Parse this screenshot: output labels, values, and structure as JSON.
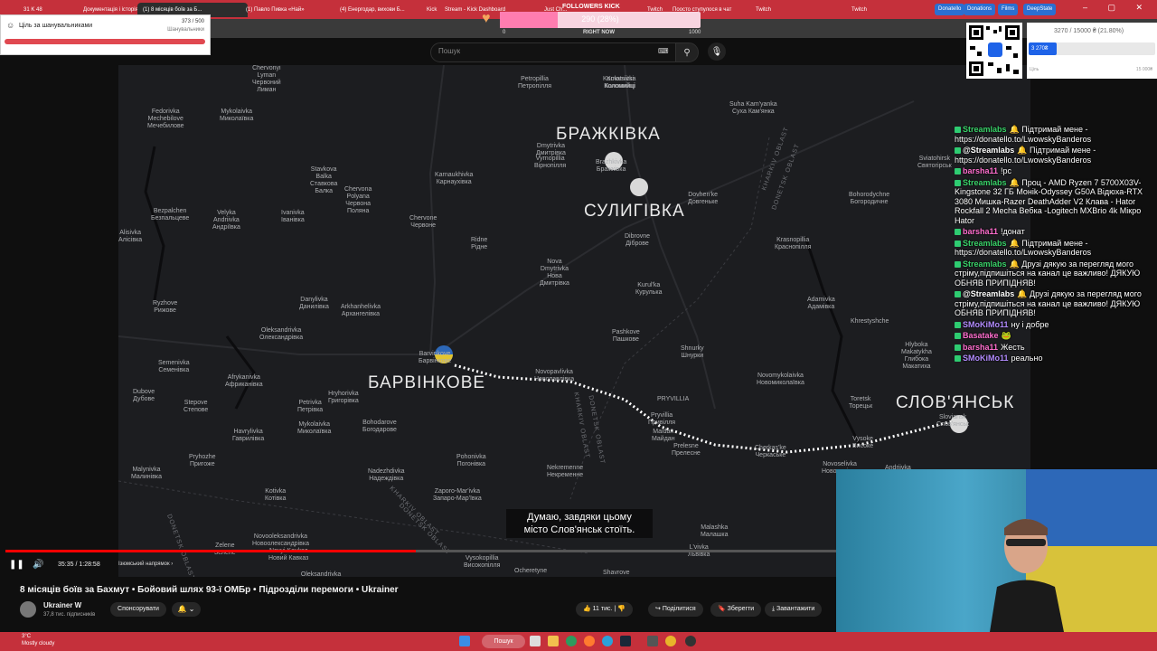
{
  "browser": {
    "tabs": [
      {
        "label": "31 K 48",
        "active": false
      },
      {
        "label": "Документація і історія",
        "active": false
      },
      {
        "label": "(1) 8 місяців боїв за Б...",
        "active": true
      },
      {
        "label": "(1) Павло Пивка «Най»",
        "active": false
      },
      {
        "label": "(4) Енергодар, вихови Б...",
        "active": false
      },
      {
        "label": "Kick",
        "active": false
      },
      {
        "label": "Stream - Kick Dashboard",
        "active": false
      },
      {
        "label": "Just Ch...",
        "active": false
      },
      {
        "label": "Twitch",
        "active": false
      },
      {
        "label": "Поосто ступулося в чат",
        "active": false
      },
      {
        "label": "Twitch",
        "active": false
      },
      {
        "label": "Twitch",
        "active": false
      }
    ],
    "bookmarks": [
      "Donatello",
      "Donations",
      "Films",
      "DeepState"
    ],
    "window_controls": "– ▢ ✕"
  },
  "youtube": {
    "search_placeholder": "Пошук",
    "video_title": "8 місяців боїв за Бахмут • Бойовий шлях 93-ї ОМБр • Підрозділи перемоги • Ukrainer",
    "channel": "Ukrainer W",
    "subscribers": "37,8 тис. підписників",
    "sponsor_label": "Спонсорувати",
    "bell_label": "🔔 ⌄",
    "actions": {
      "likes": "11 тис.",
      "share": "Поділитися",
      "save": "Зберегти",
      "download": "Завантажити"
    },
    "time": "35:35 / 1:28:58",
    "chapter": "Ізюмський напрямок ›",
    "progress": 0.4,
    "subtitle_line1": "Думаю, завдяки цьому",
    "subtitle_line2": "місто Слов'янськ стоїть."
  },
  "map": {
    "big_labels": {
      "brazh": "БРАЖКІВКА",
      "sulih": "СУЛИГІВКА",
      "barv": "БАРВІНКОВЕ",
      "slov": "СЛОВ'ЯНСЬК"
    },
    "oblast_labels": {
      "kharkiv1": "KHARKIV OBLAST",
      "donetsk1": "DONETSK OBLAST",
      "donetsk2": "DONETSK OBLAST",
      "kharkiv2": "KHARKIV OBLAST",
      "donetsk3": "DONETSK OBLAST",
      "donetsk4": "DONETSK OBLAST",
      "kharkiv3": "KHARKIV OBLAST"
    },
    "towns": [
      {
        "id": "chervonyi",
        "t": "Chervonyi\nLyman\nЧервоний\nЛиман"
      },
      {
        "id": "fedorivka",
        "t": "Fedorivka\nMechebilove\nМечебилове"
      },
      {
        "id": "mykolaivka1",
        "t": "Mykolaivka\nМиколаївка"
      },
      {
        "id": "petropillia",
        "t": "Petropillia\nПетропілля"
      },
      {
        "id": "kolomiitsi",
        "t": "Kolomiitsi\nКоломийці"
      },
      {
        "id": "kornatsivka",
        "t": "Kornatsivka\nКоломийці"
      },
      {
        "id": "suhaKam",
        "t": "Suha Kam'yanka\nСуха Кам'янка"
      },
      {
        "id": "dmytrivka",
        "t": "Dmytrivka\nДмитрівка"
      },
      {
        "id": "vyrnopillia",
        "t": "Vyrnopillia\nВірнопілля"
      },
      {
        "id": "karnaukhivka",
        "t": "Karnaukhivka\nКарнаухівка"
      },
      {
        "id": "stavkova",
        "t": "Stavkova\nBalka\nСтавкова\nБалка"
      },
      {
        "id": "chervona",
        "t": "Chervona\nPolyana\nЧервона\nПоляна"
      },
      {
        "id": "bezpalchen",
        "t": "Bezpalchen\nБезпальцеве"
      },
      {
        "id": "velyka",
        "t": "Velyka\nAndriivka\nАндріївка"
      },
      {
        "id": "ivanivka",
        "t": "Ivanivka\nІванівка"
      },
      {
        "id": "chervone",
        "t": "Chervone\nЧервоне"
      },
      {
        "id": "alisivka",
        "t": "Alisivka\nАлісівка"
      },
      {
        "id": "ridne",
        "t": "Ridne\nРідне"
      },
      {
        "id": "nova",
        "t": "Nova\nDmytrivka\nНова\nДмитрівка"
      },
      {
        "id": "dibrovne",
        "t": "Dibrovne\nДіброве"
      },
      {
        "id": "dovhenke",
        "t": "Dovhen'ke\nДовгеньке"
      },
      {
        "id": "bohorodychne",
        "t": "Bohorodychne\nБогородичне"
      },
      {
        "id": "kurulka",
        "t": "Kurul'ka\nКурулька"
      },
      {
        "id": "krasnopillia",
        "t": "Krasnopillia\nКраснопілля"
      },
      {
        "id": "ryzhove",
        "t": "Ryzhove\nРижове"
      },
      {
        "id": "danylivka",
        "t": "Danylivka\nДанилівка"
      },
      {
        "id": "arkhanhelivka",
        "t": "Arkhanhelivka\nАрхангелівка"
      },
      {
        "id": "adamivka",
        "t": "Adamivka\nАдамівка"
      },
      {
        "id": "oleksandrivka",
        "t": "Oleksandrivka\nОлександрівка"
      },
      {
        "id": "pashkove",
        "t": "Pashkove\nПашкове"
      },
      {
        "id": "khrestyshche",
        "t": "Khrestyshche"
      },
      {
        "id": "shnurky",
        "t": "Shnurky\nШнурки"
      },
      {
        "id": "semenivka",
        "t": "Semenivka\nСеменівка"
      },
      {
        "id": "dubove",
        "t": "Dubove\nДубове"
      },
      {
        "id": "afrykanivka",
        "t": "Afrykanivka\nАфриканівка"
      },
      {
        "id": "hryhorivka",
        "t": "Hryhorivka\nГригорівка"
      },
      {
        "id": "novopavlivka",
        "t": "Novopavlivka\nНовопавлівка"
      },
      {
        "id": "novomykolaivka",
        "t": "Novomykolaivka\nНовомиколаївка"
      },
      {
        "id": "hlyboka",
        "t": "Hlyboka\nMakatykha\nГлибока\nМакатиха"
      },
      {
        "id": "stepove",
        "t": "Stepove\nСтепове"
      },
      {
        "id": "petrivka",
        "t": "Petrivka\nПетрівка"
      },
      {
        "id": "pryvillia",
        "t": "PRYVILLIA"
      },
      {
        "id": "pryvillia2",
        "t": "Pryvillia\nПривілля"
      },
      {
        "id": "toretsk",
        "t": "Toretsk\nТорецьк"
      },
      {
        "id": "havrylivka",
        "t": "Havrylivka\nГаврилівка"
      },
      {
        "id": "mykolaivka2",
        "t": "Mykolaivka\nМиколаївка"
      },
      {
        "id": "bohodarove",
        "t": "Bohodarove\nБогодарове"
      },
      {
        "id": "maidan",
        "t": "Maidan\nМайдан"
      },
      {
        "id": "prelesne",
        "t": "Prelesne\nПрелесне"
      },
      {
        "id": "cherkaske",
        "t": "Cherkas'ke\nЧеркаське"
      },
      {
        "id": "vysoke",
        "t": "Vysoke\nВисоке"
      },
      {
        "id": "pryhozhe",
        "t": "Pryhozhe\nПригоже"
      },
      {
        "id": "pohonivka",
        "t": "Pohonivka\nПогонівка"
      },
      {
        "id": "nekremenne",
        "t": "Nekremenne\nНекременне"
      },
      {
        "id": "novoselivka",
        "t": "Novoselivka\nНовоселівка"
      },
      {
        "id": "andriivka",
        "t": "Andriivka"
      },
      {
        "id": "nadezhdivka",
        "t": "Nadezhdivka\nНадеждівка"
      },
      {
        "id": "malynivka",
        "t": "Malynivka\nМалинівка"
      },
      {
        "id": "kotivka",
        "t": "Kotivka\nКотівка"
      },
      {
        "id": "zaporomarivka",
        "t": "Zaporo-Mar'ivka\nЗапаро-Мар'ївка"
      },
      {
        "id": "novoolek",
        "t": "Novooleksandrivka\nНовоолександрівка"
      },
      {
        "id": "novyi",
        "t": "Novyi Kavkaz\nНовий Кавказ"
      },
      {
        "id": "zelene",
        "t": "Zelene\nЗелене"
      },
      {
        "id": "vysokopillia",
        "t": "Vysokopillia\nВисокопілля"
      },
      {
        "id": "oleksandrivka2",
        "t": "Oleksandrivka\nОлександрівка"
      },
      {
        "id": "malashka",
        "t": "Malashka\nМалашка"
      },
      {
        "id": "lvivka",
        "t": "L'vivka\nЛьвівка"
      },
      {
        "id": "ocheretyne",
        "t": "Ocheretyne"
      },
      {
        "id": "shavrove",
        "t": "Shavrove"
      },
      {
        "id": "raihorodok",
        "t": "Raihorodok\nРайгородок"
      },
      {
        "id": "sviatohirsk",
        "t": "Sviatohirsk\nСвятогірськ"
      },
      {
        "id": "slovsmall",
        "t": "Sloviansk\nСлов'янськ"
      },
      {
        "id": "brazhsmall",
        "t": "Brazhkivka\nБражківка"
      },
      {
        "id": "barvsmall",
        "t": "Barvinkove\nБарвінкове"
      }
    ]
  },
  "widgets": {
    "goal_title": "Ціль за шанувальниками",
    "goal_count": "373 / 500",
    "goal_sub": "Шанувальники",
    "followers_title": "FOLLOWERS KICK",
    "followers_value": "290 (28%)",
    "followers_fraction": 0.29,
    "followers_min": "0",
    "followers_now": "RIGHT NOW",
    "followers_max": "1000",
    "donation_amount": "3270 / 15000 ₴ (21.80%)",
    "donation_fill_label": "3 270₴",
    "donation_fraction": 0.218,
    "donation_min": "Ціль",
    "donation_max": "15 000₴"
  },
  "chat": [
    {
      "user": "Streamlabs",
      "color": "#3ad36a",
      "text": "🔔 Підтримай мене - https://donatello.to/LwowskyBanderos"
    },
    {
      "user": "@Streamlabs",
      "color": "#ffffff",
      "text": "🔔 Підтримай мене - https://donatello.to/LwowskyBanderos"
    },
    {
      "user": "barsha11",
      "color": "#ff6fcf",
      "text": "!pc"
    },
    {
      "user": "Streamlabs",
      "color": "#3ad36a",
      "text": "🔔 Проц - AMD Ryzen 7 5700X03V-Kingstone 32 ГБ Моніk-Odyssey G50A Відюха-RTX 3080 Мишка-Razer DeathAdder V2 Клава - Hator Rockfall 2 Mecha Вебка -Logitech MXBrio 4k Мікро Hator"
    },
    {
      "user": "barsha11",
      "color": "#ff6fcf",
      "text": "!донат"
    },
    {
      "user": "Streamlabs",
      "color": "#3ad36a",
      "text": "🔔 Підтримай мене - https://donatello.to/LwowskyBanderos"
    },
    {
      "user": "Streamlabs",
      "color": "#3ad36a",
      "text": "🔔 Друзі дякую за перегляд мого стріму,підпишіться на канал це важливо! ДЯКУЮ ОБНЯВ ПРИПІДНЯВ!"
    },
    {
      "user": "@Streamlabs",
      "color": "#ffffff",
      "text": "🔔 Друзі дякую за перегляд мого стріму,підпишіться на канал це важливо! ДЯКУЮ ОБНЯВ ПРИПІДНЯВ!"
    },
    {
      "user": "SMoKiMo11",
      "color": "#b38cff",
      "text": "ну і добре"
    },
    {
      "user": "Basatake",
      "color": "#ff6fcf",
      "text": "🐸"
    },
    {
      "user": "barsha11",
      "color": "#ff6fcf",
      "text": "Жесть"
    },
    {
      "user": "SMoKiMo11",
      "color": "#b38cff",
      "text": "реально"
    }
  ],
  "taskbar": {
    "weather_temp": "3°C",
    "weather_desc": "Mostly cloudy",
    "search_label": "Пошук"
  },
  "colors": {
    "accent_red": "#c5303b",
    "youtube_red": "#ff0000",
    "map_bg": "#1c1d20",
    "route": "#ffffff"
  }
}
